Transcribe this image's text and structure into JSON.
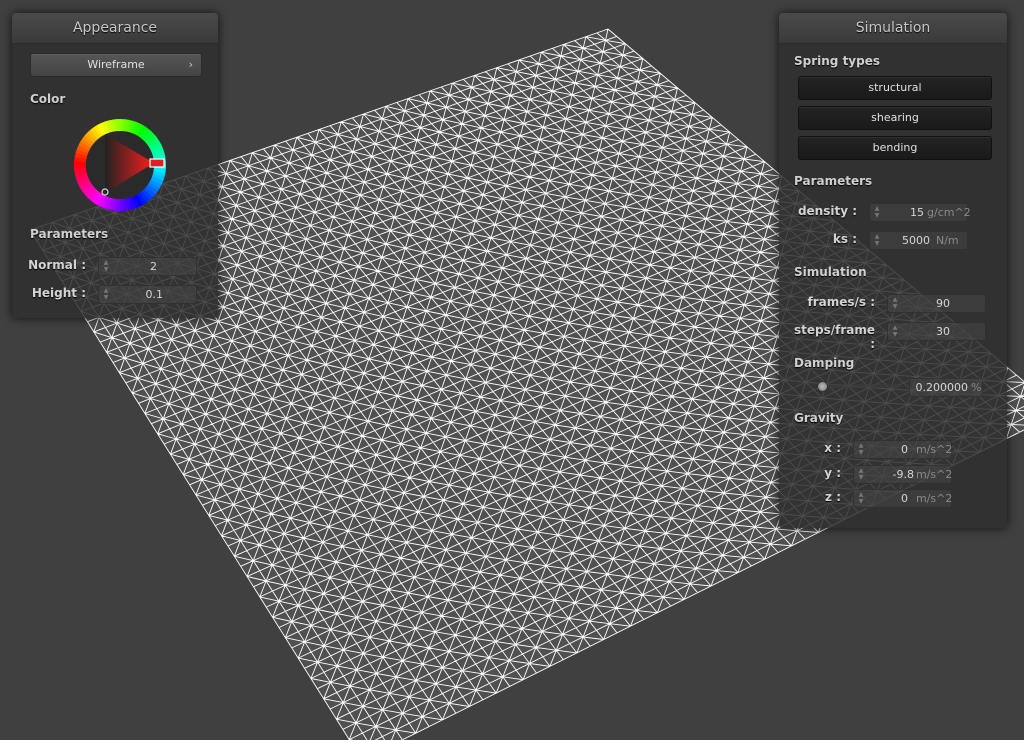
{
  "colors": {
    "background": "#404040",
    "mesh": "#ffffff",
    "panel": "#2e2e2e",
    "accent_red": "#e02020"
  },
  "appearance": {
    "title": "Appearance",
    "shader_button": "Wireframe",
    "shader_chevron": "›",
    "color_label": "Color",
    "params_label": "Parameters",
    "normal_label": "Normal :",
    "normal_value": "2",
    "height_label": "Height :",
    "height_value": "0.1"
  },
  "simulation": {
    "title": "Simulation",
    "spring_types_label": "Spring types",
    "springs": [
      "structural",
      "shearing",
      "bending"
    ],
    "params_label": "Parameters",
    "density_label": "density :",
    "density_value": "15",
    "density_unit": "g/cm^2",
    "ks_label": "ks :",
    "ks_value": "5000",
    "ks_unit": "N/m",
    "sim_label": "Simulation",
    "fps_label": "frames/s :",
    "fps_value": "90",
    "steps_label": "steps/frame :",
    "steps_value": "30",
    "damping_label": "Damping",
    "damping_value": "0.200000",
    "damping_unit": "%",
    "damping_level": 0.002,
    "gravity_label": "Gravity",
    "gx_label": "x :",
    "gx_value": "0",
    "gx_unit": "m/s^2",
    "gy_label": "y :",
    "gy_value": "-9.8",
    "gy_unit": "m/s^2",
    "gz_label": "z :",
    "gz_value": "0",
    "gz_unit": "m/s^2"
  }
}
